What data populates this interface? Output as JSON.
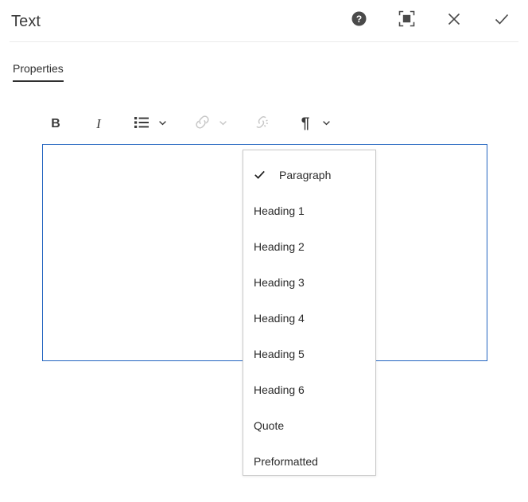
{
  "header": {
    "title": "Text",
    "actions": [
      {
        "name": "help-icon",
        "label": "Help"
      },
      {
        "name": "fullscreen-icon",
        "label": "Fullscreen"
      },
      {
        "name": "close-icon",
        "label": "Close"
      },
      {
        "name": "confirm-check-icon",
        "label": "Done"
      }
    ]
  },
  "tabs": [
    {
      "label": "Properties",
      "active": true
    }
  ],
  "toolbar": {
    "bold_label": "B",
    "italic_label": "I",
    "list_label": "Bulleted list",
    "link_label": "Link",
    "unlink_label": "Unlink",
    "paragraph_label": "¶"
  },
  "editor": {
    "content": ""
  },
  "dropdown": {
    "items": [
      {
        "label": "Paragraph",
        "checked": true
      },
      {
        "label": "Heading 1",
        "checked": false
      },
      {
        "label": "Heading 2",
        "checked": false
      },
      {
        "label": "Heading 3",
        "checked": false
      },
      {
        "label": "Heading 4",
        "checked": false
      },
      {
        "label": "Heading 5",
        "checked": false
      },
      {
        "label": "Heading 6",
        "checked": false
      },
      {
        "label": "Quote",
        "checked": false
      },
      {
        "label": "Preformatted",
        "checked": false
      }
    ]
  },
  "colors": {
    "accent_border": "#2264c0",
    "text": "#2b2b2b",
    "disabled": "#c7c7c7",
    "divider": "#ebebeb"
  }
}
